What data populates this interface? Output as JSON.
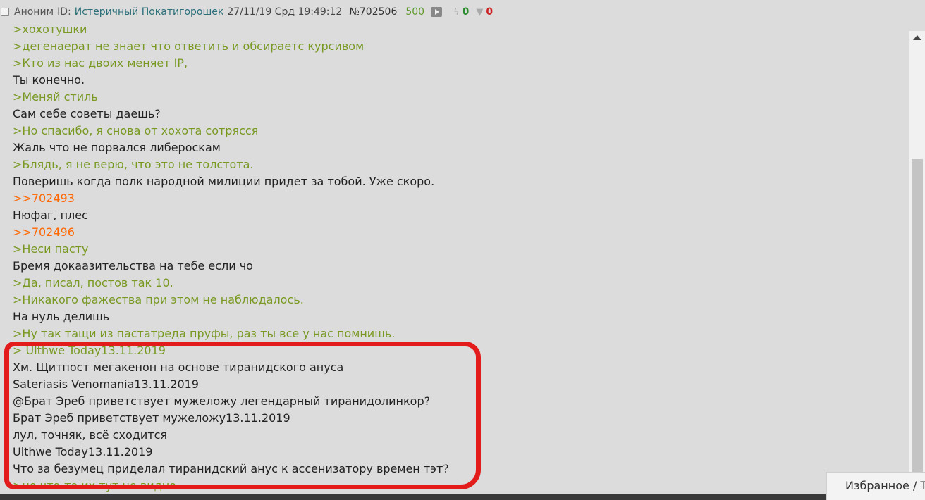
{
  "header": {
    "name": "Аноним",
    "id_label": "ID:",
    "title": "Истеричный Покатигорошек",
    "date": "27/11/19 Срд 19:49:12",
    "post_number": "№702506",
    "count": "500",
    "likes": "0",
    "dislikes": "0"
  },
  "lines": [
    {
      "type": "quote",
      "text": ">хохотушки"
    },
    {
      "type": "quote",
      "text": ">дегенаерат не знает что ответить и обсираетс курсивом"
    },
    {
      "type": "quote",
      "text": ">Кто из нас двоих меняет IP,"
    },
    {
      "type": "text",
      "text": "Ты конечно."
    },
    {
      "type": "quote",
      "text": ">Меняй стиль"
    },
    {
      "type": "text",
      "text": "Сам себе советы даешь?"
    },
    {
      "type": "quote",
      "text": ">Но спасибо, я снова от хохота сотрясся"
    },
    {
      "type": "text",
      "text": "Жаль что не порвался либероскам"
    },
    {
      "type": "quote",
      "text": ">Блядь, я не верю, что это не толстота."
    },
    {
      "type": "text",
      "text": "Поверишь когда полк народной милиции придет за тобой. Уже скоро."
    },
    {
      "type": "reply",
      "text": ">>702493"
    },
    {
      "type": "text",
      "text": "Нюфаг, плес"
    },
    {
      "type": "reply",
      "text": ">>702496"
    },
    {
      "type": "quote",
      "text": ">Неси пасту"
    },
    {
      "type": "text",
      "text": "Бремя докаазительства на тебе если чо"
    },
    {
      "type": "quote",
      "text": ">Да, писал, постов так 10."
    },
    {
      "type": "quote",
      "text": ">Никакого фажества при этом не наблюдалось."
    },
    {
      "type": "text",
      "text": "На нуль делишь"
    },
    {
      "type": "quote",
      "text": ">Ну так тащи из пастатреда пруфы, раз ты все у нас помнишь."
    },
    {
      "type": "quote",
      "text": "> Ulthwe Today13.11.2019"
    },
    {
      "type": "text",
      "text": "Хм. Щитпост мегакенон на основе тиранидского ануса"
    },
    {
      "type": "text",
      "text": "Sateriasis Venomania13.11.2019"
    },
    {
      "type": "text",
      "text": "@Брат Эреб приветствует мужеложу легендарный тиранидолинкор?"
    },
    {
      "type": "text",
      "text": "Брат Эреб приветствует мужеложу13.11.2019"
    },
    {
      "type": "text",
      "text": "лул, точняк, всё сходится"
    },
    {
      "type": "text",
      "text": "Ulthwe Today13.11.2019"
    },
    {
      "type": "text",
      "text": "Что за безумец приделал тиранидский анус к ассенизатору времен тэт?"
    },
    {
      "type": "quote",
      "text": ">но что-то их тут не видно"
    }
  ],
  "favorites_label": "Избранное / Т"
}
